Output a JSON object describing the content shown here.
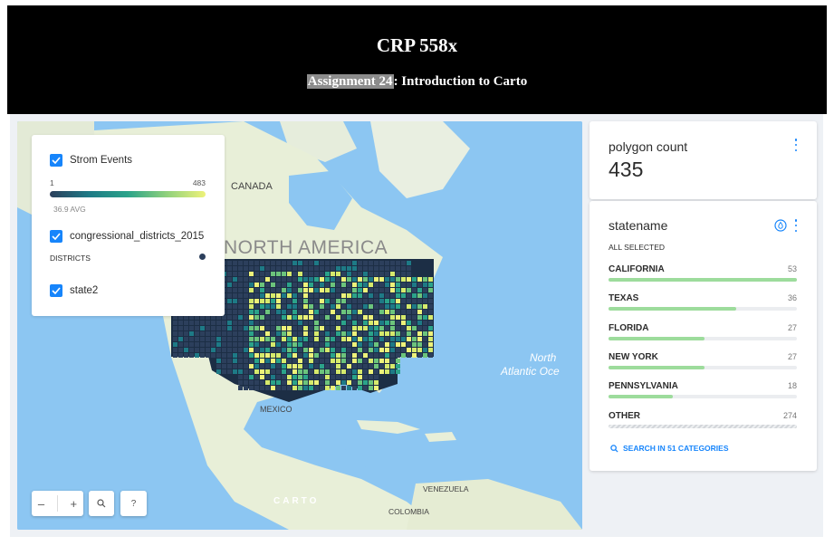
{
  "header": {
    "title": "CRP 558x",
    "subtitle_highlight": "Assignment 24",
    "subtitle_rest": ": Introduction to Carto"
  },
  "legend": {
    "layers": [
      {
        "name": "Strom Events",
        "checked": true,
        "min": "1",
        "max": "483",
        "avg": "36.9 AVG"
      },
      {
        "name": "congressional_districts_2015",
        "checked": true,
        "sub_label": "DISTRICTS"
      },
      {
        "name": "state2",
        "checked": true
      }
    ],
    "ramp_colors": [
      "#2c3f5c",
      "#1e7a86",
      "#2ba38a",
      "#8fd17c",
      "#eef27a"
    ]
  },
  "map_labels": {
    "canada": "CANADA",
    "north_america": "NORTH AMERICA",
    "north_atlantic_line1": "North",
    "north_atlantic_line2": "Atlantic Oce",
    "mexico": "MEXICO",
    "venezuela": "VENEZUELA",
    "colombia": "COLOMBIA",
    "attribution": "CARTO"
  },
  "map_controls": {
    "zoom_out": "–",
    "zoom_in": "+",
    "search_icon": "magnifier-icon",
    "help": "?"
  },
  "widget_count": {
    "title": "polygon count",
    "value": "435"
  },
  "widget_category": {
    "title": "statename",
    "all_selected": "ALL SELECTED",
    "categories": [
      {
        "name": "CALIFORNIA",
        "value": "53",
        "fraction": 1.0
      },
      {
        "name": "TEXAS",
        "value": "36",
        "fraction": 0.68
      },
      {
        "name": "FLORIDA",
        "value": "27",
        "fraction": 0.51
      },
      {
        "name": "NEW YORK",
        "value": "27",
        "fraction": 0.51
      },
      {
        "name": "PENNSYLVANIA",
        "value": "18",
        "fraction": 0.34
      },
      {
        "name": "OTHER",
        "value": "274",
        "fraction": 1.0
      }
    ],
    "search_link": "SEARCH IN 51 CATEGORIES"
  },
  "colors": {
    "accent": "#1785fb",
    "bar_fill": "#9ddc9c",
    "water": "#8cc6f2",
    "land": "#e8efd8"
  }
}
